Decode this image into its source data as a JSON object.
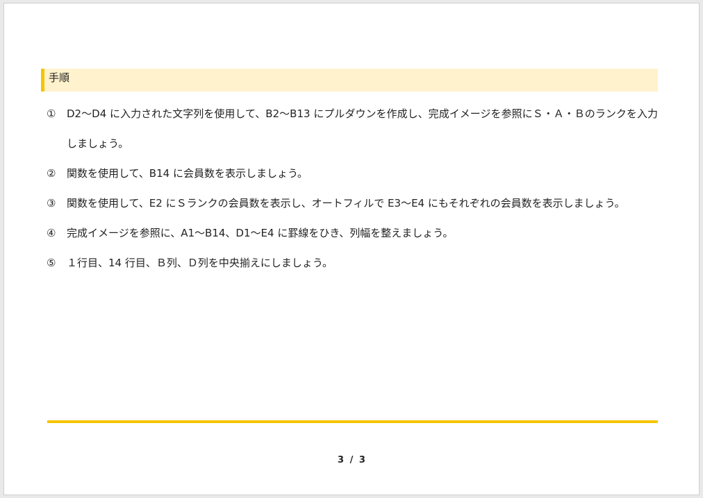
{
  "section": {
    "title": "手順"
  },
  "steps": [
    {
      "number": "①",
      "text": "D2～D4 に入力された文字列を使用して、B2～B13 にプルダウンを作成し、完成イメージを参照にＳ・Ａ・Ｂのランクを入力しましょう。"
    },
    {
      "number": "②",
      "text": "関数を使用して、B14 に会員数を表示しましょう。"
    },
    {
      "number": "③",
      "text": "関数を使用して、E2 にＳランクの会員数を表示し、オートフィルで E3～E4 にもそれぞれの会員数を表示しましょう。"
    },
    {
      "number": "④",
      "text": "完成イメージを参照に、A1～B14、D1～E4 に罫線をひき、列幅を整えましょう。"
    },
    {
      "number": "⑤",
      "text": "１行目、14 行目、Ｂ列、Ｄ列を中央揃えにしましょう。"
    }
  ],
  "footer": {
    "page_number": "3 / 3"
  },
  "colors": {
    "accent": "#f5c400",
    "header_background": "#fff2cc"
  }
}
